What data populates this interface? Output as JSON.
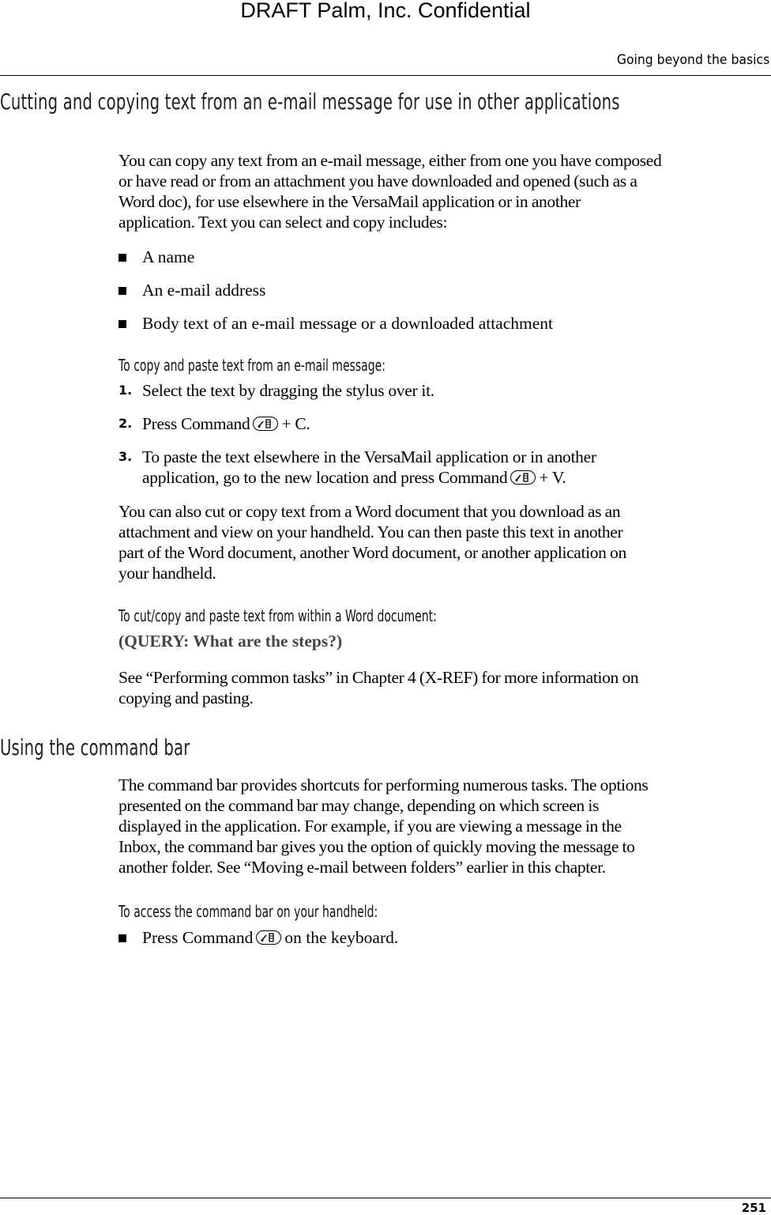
{
  "watermark": "DRAFT   Palm, Inc. Confidential",
  "running_head": "Going beyond the basics",
  "page_number": "251",
  "sections": [
    {
      "heading": "Cutting and copying text from an e-mail message for use in other applications",
      "intro_lines": [
        "You can copy any text from an e-mail message, either from one you have composed",
        "or have read or from an attachment you have downloaded and opened (such as a",
        "Word doc), for use elsewhere in the VersaMail application or in another",
        "application. Text you can select and copy includes:"
      ],
      "bullets": [
        "A name",
        "An e-mail address",
        "Body text of an e-mail message or a downloaded attachment"
      ],
      "procedure1_title": "To copy and paste text from an e-mail message:",
      "steps": [
        {
          "num": "1.",
          "lines": [
            "Select the text by dragging the stylus over it."
          ]
        },
        {
          "num": "2.",
          "before": "Press Command",
          "after": "+ C."
        },
        {
          "num": "3.",
          "line1": "To paste the text elsewhere in the VersaMail application or in another",
          "before": "application, go to the new location and press Command",
          "after": "+ V."
        }
      ],
      "word_para_lines": [
        "You can also cut or copy text from a Word document that you download as an",
        "attachment and view on your handheld. You can then paste this text in another",
        "part of the Word document, another Word document, or another application on",
        "your handheld."
      ],
      "procedure2_title": "To cut/copy and paste text from within a Word document:",
      "query": "(QUERY: What are the steps?)",
      "see_lines": [
        "See “Performing common tasks” in Chapter 4 (X-REF) for more information on",
        "copying and pasting."
      ]
    },
    {
      "heading": "Using the command bar",
      "intro_lines": [
        "The command bar provides shortcuts for performing numerous tasks. The options",
        "presented on the command bar may change, depending on which screen is",
        "displayed in the application. For example, if you are viewing a message in the",
        "Inbox, the command bar gives you the option of quickly moving the message to",
        "another folder. See “Moving e-mail between folders” earlier in this chapter."
      ],
      "procedure_title": "To access the command bar on your handheld:",
      "bullet_before": "Press Command",
      "bullet_after": "on the keyboard."
    }
  ],
  "icons": {
    "command_key": "command-key-icon"
  }
}
